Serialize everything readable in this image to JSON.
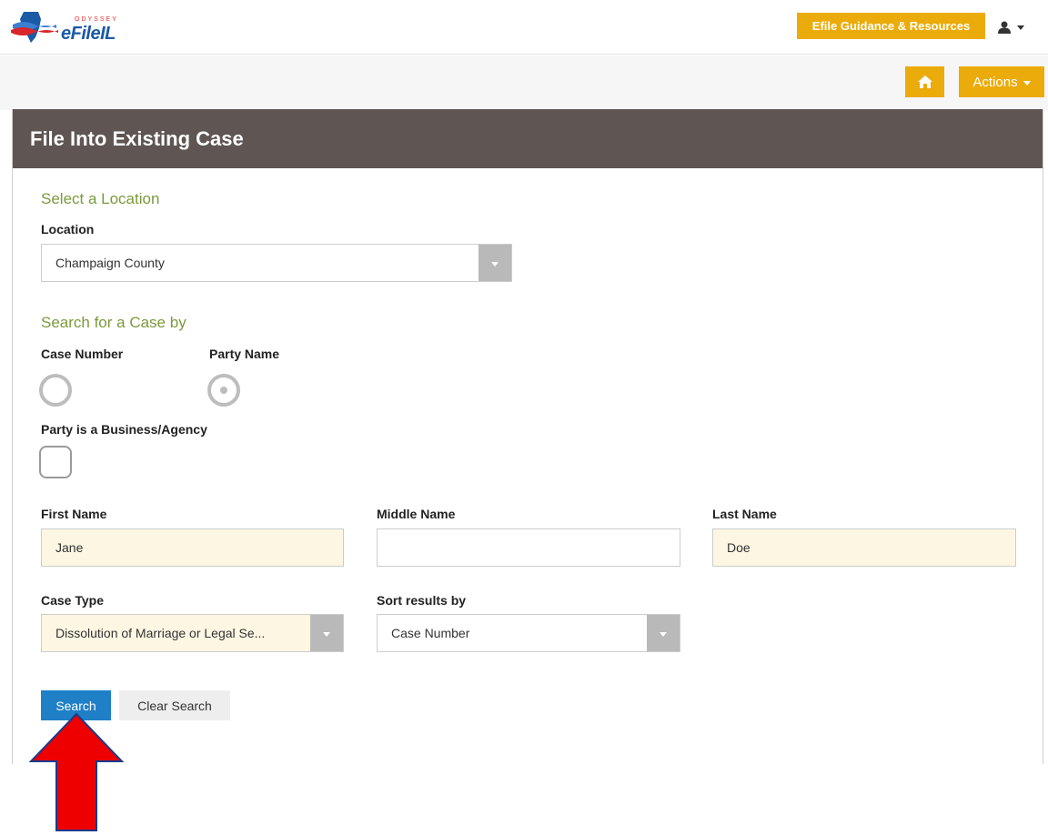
{
  "header": {
    "logo_small": "ODYSSEY",
    "logo_big": "eFileIL",
    "guidance_label": "Efile Guidance & Resources",
    "actions_label": "Actions"
  },
  "panel": {
    "title": "File Into Existing Case"
  },
  "location_section": {
    "title": "Select a Location",
    "field_label": "Location",
    "selected": "Champaign County"
  },
  "search_section": {
    "title": "Search for a Case by",
    "options": [
      {
        "label": "Case Number",
        "checked": false
      },
      {
        "label": "Party Name",
        "checked": true
      }
    ],
    "business_label": "Party is a Business/Agency",
    "business_checked": false
  },
  "name_fields": {
    "first_label": "First Name",
    "first_value": "Jane",
    "middle_label": "Middle Name",
    "middle_value": "",
    "last_label": "Last Name",
    "last_value": "Doe"
  },
  "case_fields": {
    "case_type_label": "Case Type",
    "case_type_value": "Dissolution of Marriage or Legal Se...",
    "sort_label": "Sort results by",
    "sort_value": "Case Number"
  },
  "buttons": {
    "search": "Search",
    "clear": "Clear Search"
  },
  "colors": {
    "accent": "#ebab0a",
    "header_bg": "#5f5553",
    "primary": "#1f7fc7",
    "section_title": "#7a9a3c",
    "annotation_arrow": "#ee0000"
  }
}
